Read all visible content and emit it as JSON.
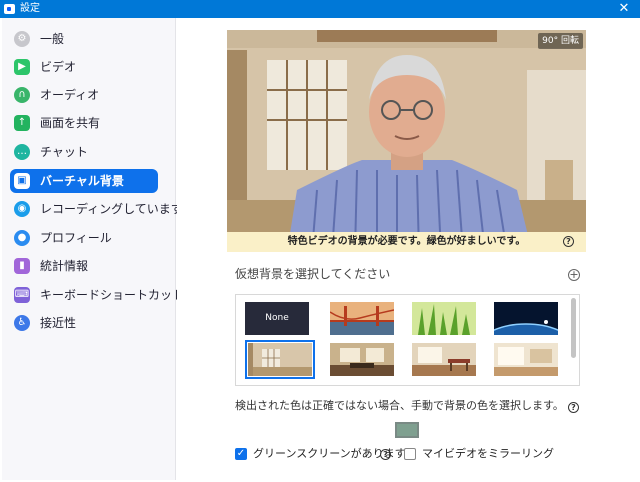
{
  "window": {
    "title": "設定",
    "close_glyph": "✕"
  },
  "sidebar": {
    "items": [
      {
        "label": "一般",
        "icon": "gear-icon",
        "color": "#c7c7cc"
      },
      {
        "label": "ビデオ",
        "icon": "video-camera-icon",
        "color": "#2dc56a"
      },
      {
        "label": "オーディオ",
        "icon": "headphones-icon",
        "color": "#39b56a"
      },
      {
        "label": "画面を共有",
        "icon": "share-screen-icon",
        "color": "#23b35f"
      },
      {
        "label": "チャット",
        "icon": "chat-bubble-icon",
        "color": "#1fb5a0"
      },
      {
        "label": "バーチャル背景",
        "icon": "virtual-background-icon",
        "color": "#0e71eb",
        "active": true
      },
      {
        "label": "レコーディングしています",
        "icon": "record-icon",
        "color": "#1a9dea"
      },
      {
        "label": "プロフィール",
        "icon": "person-icon",
        "color": "#2b8cf0"
      },
      {
        "label": "統計情報",
        "icon": "bar-chart-icon",
        "color": "#a166d9"
      },
      {
        "label": "キーボードショートカット",
        "icon": "keyboard-icon",
        "color": "#7f62d8"
      },
      {
        "label": "接近性",
        "icon": "accessibility-icon",
        "color": "#3d78e8"
      }
    ]
  },
  "preview": {
    "rotate_label": "90° 回転",
    "warning": "特色ビデオの背景が必要です。緑色が好ましいです。",
    "help_glyph": "?"
  },
  "backgrounds": {
    "section_label": "仮想背景を選択してください",
    "add_glyph": "+",
    "none_label": "None",
    "thumbnails": [
      {
        "name": "none"
      },
      {
        "name": "golden-gate-bridge"
      },
      {
        "name": "grass"
      },
      {
        "name": "earth-from-space"
      },
      {
        "name": "room-interior",
        "selected": true
      },
      {
        "name": "living-room"
      },
      {
        "name": "dining-room"
      },
      {
        "name": "bright-room"
      }
    ]
  },
  "color_detect": {
    "note": "検出された色は正確ではない場合、手動で背景の色を選択します。",
    "help_glyph": "?",
    "swatch_color": "#7fa090"
  },
  "options": {
    "green_screen": {
      "label": "グリーンスクリーンがあります",
      "checked": true,
      "help_glyph": "?"
    },
    "mirror": {
      "label": "マイビデオをミラーリング",
      "checked": false
    }
  }
}
